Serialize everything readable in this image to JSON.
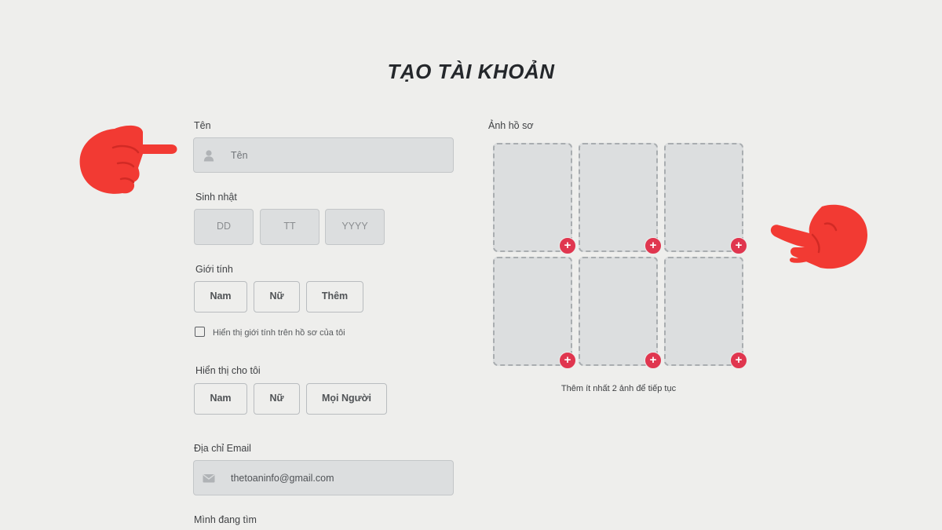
{
  "page": {
    "title": "TẠO TÀI KHOẢN"
  },
  "form": {
    "name": {
      "label": "Tên",
      "placeholder": "Tên",
      "icon": "user-icon"
    },
    "birthday": {
      "label": "Sinh nhật",
      "day": "DD",
      "month": "TT",
      "year": "YYYY"
    },
    "gender": {
      "label": "Giới tính",
      "options": [
        "Nam",
        "Nữ",
        "Thêm"
      ],
      "show_checkbox_label": "Hiển thị giới tính trên hồ sơ của tôi"
    },
    "show_me": {
      "label": "Hiển thị cho tôi",
      "options": [
        "Nam",
        "Nữ",
        "Mọi Người"
      ]
    },
    "email": {
      "label": "Địa chỉ Email",
      "value": "thetoaninfo@gmail.com",
      "icon": "mail-icon"
    },
    "looking_for": {
      "label": "Mình đang tìm"
    }
  },
  "photos": {
    "label": "Ảnh hồ sơ",
    "add_symbol": "+",
    "hint": "Thêm ít nhất 2 ảnh để tiếp tục"
  },
  "colors": {
    "accent": "#e0364f",
    "pointer": "#f23a33",
    "background": "#eeeeec"
  }
}
